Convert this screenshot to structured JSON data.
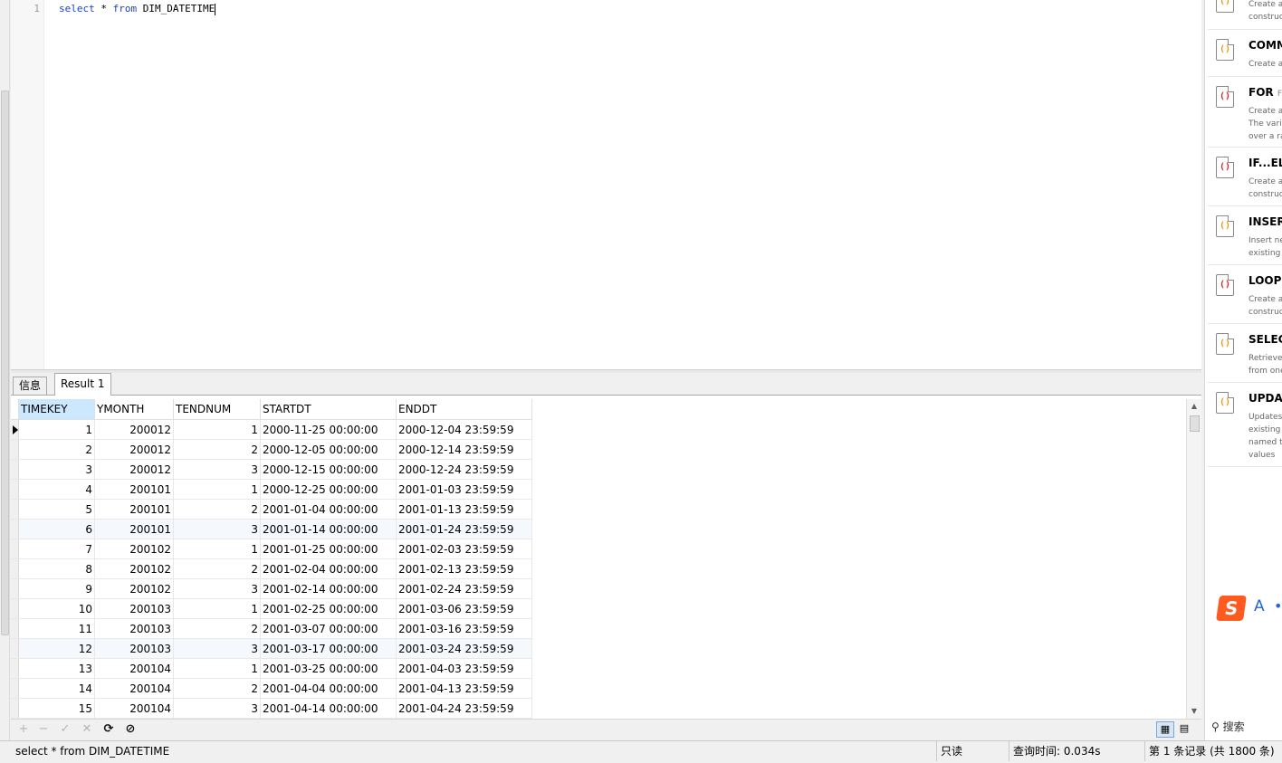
{
  "editor": {
    "line_number": "1",
    "query_keyword_select": "select",
    "query_star": " * ",
    "query_keyword_from": "from",
    "query_table": " DIM_DATETIME"
  },
  "tabs": [
    {
      "label": "信息"
    },
    {
      "label": "Result 1"
    }
  ],
  "grid": {
    "columns": [
      "TIMEKEY",
      "YMONTH",
      "TENDNUM",
      "STARTDT",
      "ENDDT"
    ],
    "rows": [
      [
        "1",
        "200012",
        "1",
        "2000-11-25 00:00:00",
        "2000-12-04 23:59:59"
      ],
      [
        "2",
        "200012",
        "2",
        "2000-12-05 00:00:00",
        "2000-12-14 23:59:59"
      ],
      [
        "3",
        "200012",
        "3",
        "2000-12-15 00:00:00",
        "2000-12-24 23:59:59"
      ],
      [
        "4",
        "200101",
        "1",
        "2000-12-25 00:00:00",
        "2001-01-03 23:59:59"
      ],
      [
        "5",
        "200101",
        "2",
        "2001-01-04 00:00:00",
        "2001-01-13 23:59:59"
      ],
      [
        "6",
        "200101",
        "3",
        "2001-01-14 00:00:00",
        "2001-01-24 23:59:59"
      ],
      [
        "7",
        "200102",
        "1",
        "2001-01-25 00:00:00",
        "2001-02-03 23:59:59"
      ],
      [
        "8",
        "200102",
        "2",
        "2001-02-04 00:00:00",
        "2001-02-13 23:59:59"
      ],
      [
        "9",
        "200102",
        "3",
        "2001-02-14 00:00:00",
        "2001-02-24 23:59:59"
      ],
      [
        "10",
        "200103",
        "1",
        "2001-02-25 00:00:00",
        "2001-03-06 23:59:59"
      ],
      [
        "11",
        "200103",
        "2",
        "2001-03-07 00:00:00",
        "2001-03-16 23:59:59"
      ],
      [
        "12",
        "200103",
        "3",
        "2001-03-17 00:00:00",
        "2001-03-24 23:59:59"
      ],
      [
        "13",
        "200104",
        "1",
        "2001-03-25 00:00:00",
        "2001-04-03 23:59:59"
      ],
      [
        "14",
        "200104",
        "2",
        "2001-04-04 00:00:00",
        "2001-04-13 23:59:59"
      ],
      [
        "15",
        "200104",
        "3",
        "2001-04-14 00:00:00",
        "2001-04-24 23:59:59"
      ]
    ],
    "highlighted_rows": [
      6,
      12
    ],
    "current_row": 1
  },
  "toolbar": {
    "add": "+",
    "remove": "−",
    "apply": "✓",
    "discard": "✕",
    "refresh": "⟳",
    "stop": "⊘",
    "grid_view": "▦",
    "form_view": "▤"
  },
  "status": {
    "query": "select * from DIM_DATETIME",
    "readonly": "只读",
    "query_time": "查询时间: 0.034s",
    "record": "第 1 条记录 (共 1800 条)"
  },
  "snippets": [
    {
      "title": "",
      "subtitle": "",
      "desc": "Create a\nconstruc"
    },
    {
      "title": "COMM",
      "subtitle": "",
      "desc": "Create a",
      "icon_color": "#e69a1a"
    },
    {
      "title": "FOR",
      "subtitle": "Fl",
      "desc": "Create a\nThe varia\nover a ra",
      "icon_color": "#d9262e"
    },
    {
      "title": "IF...ELS",
      "subtitle": "",
      "desc": "Create a\nconstruc",
      "icon_color": "#d9262e"
    },
    {
      "title": "INSERT",
      "subtitle": "",
      "desc": "Insert ne\nexisting t",
      "icon_color": "#e69a1a"
    },
    {
      "title": "LOOP",
      "subtitle": "",
      "desc": "Create a\nconstruc",
      "icon_color": "#d9262e"
    },
    {
      "title": "SELECT",
      "subtitle": "",
      "desc": "Retrieve\nfrom one",
      "icon_color": "#e69a1a"
    },
    {
      "title": "UPDAT",
      "subtitle": "",
      "desc": "Updates\nexisting r\nnamed ta\nvalues",
      "icon_color": "#e69a1a"
    }
  ],
  "ime": {
    "logo": "S",
    "mode": "A",
    "dot": "•"
  },
  "search": {
    "label": "搜索",
    "icon": "search-icon"
  }
}
